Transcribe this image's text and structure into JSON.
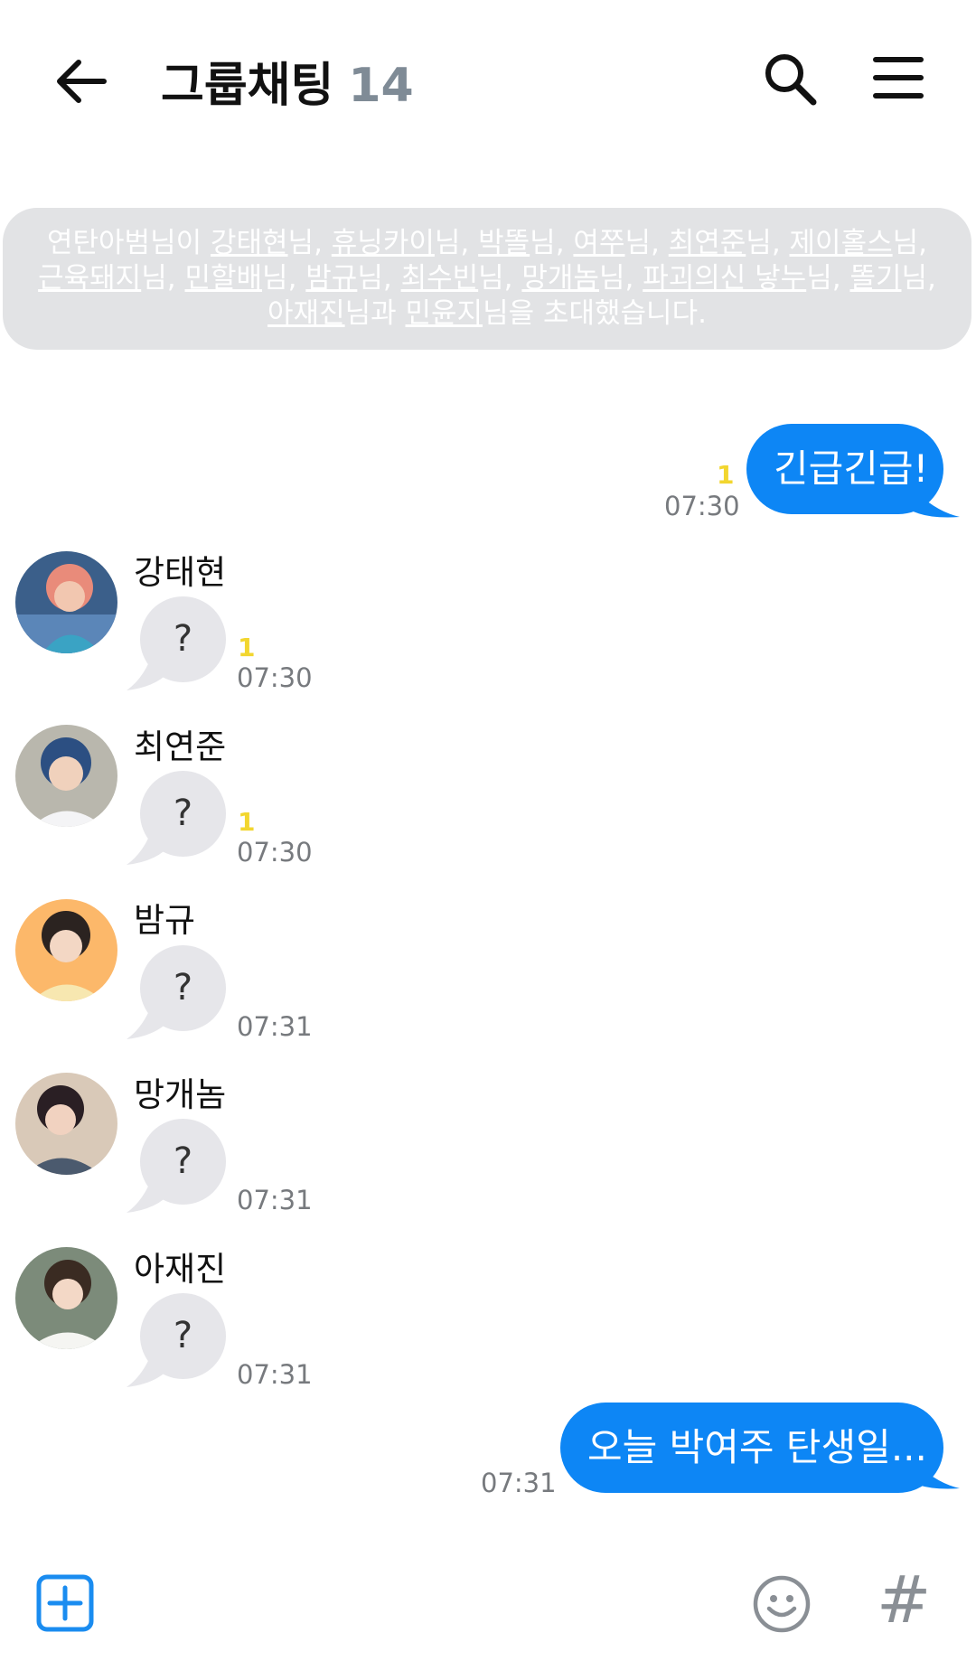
{
  "header": {
    "title": "그룹채팅",
    "member_count": "14",
    "icons": {
      "back": "back-arrow-icon",
      "search": "search-icon",
      "menu": "hamburger-menu-icon"
    }
  },
  "notice": {
    "inviter": "연탄아범",
    "invited": [
      "강태현",
      "휴닝카이",
      "박똘",
      "여쭈",
      "최연준",
      "제이홀스",
      "근육돼지",
      "민할배",
      "밤규",
      "최수빈",
      "망개놈",
      "파괴의신 낳누",
      "똘기",
      "아재진",
      "민윤지"
    ],
    "honorific": "님",
    "comma": ", ",
    "lead": "이 ",
    "and": "과 ",
    "suffix": "을 초대했습니다."
  },
  "messages": [
    {
      "type": "out",
      "text": "긴급긴급!",
      "unread": "1",
      "time": "07:30"
    },
    {
      "type": "in",
      "sender": "강태현",
      "text": "?",
      "unread": "1",
      "time": "07:30"
    },
    {
      "type": "in",
      "sender": "최연준",
      "text": "?",
      "unread": "1",
      "time": "07:30"
    },
    {
      "type": "in",
      "sender": "밤규",
      "text": "?",
      "unread": "",
      "time": "07:31"
    },
    {
      "type": "in",
      "sender": "망개놈",
      "text": "?",
      "unread": "",
      "time": "07:31"
    },
    {
      "type": "in",
      "sender": "아재진",
      "text": "?",
      "unread": "",
      "time": "07:31"
    },
    {
      "type": "out",
      "text": "오늘 박여주 탄생일...",
      "unread": "",
      "time": "07:31"
    }
  ],
  "colors": {
    "out_bubble": "#0d86f5",
    "in_bubble": "#e6e6ea",
    "notice_bg": "#e2e3e5",
    "unread": "#f2d62f",
    "add_button": "#1a8cf0"
  },
  "bottom_bar": {
    "add": "plus-square-icon",
    "emoji": "smiley-icon",
    "hash": "#"
  }
}
